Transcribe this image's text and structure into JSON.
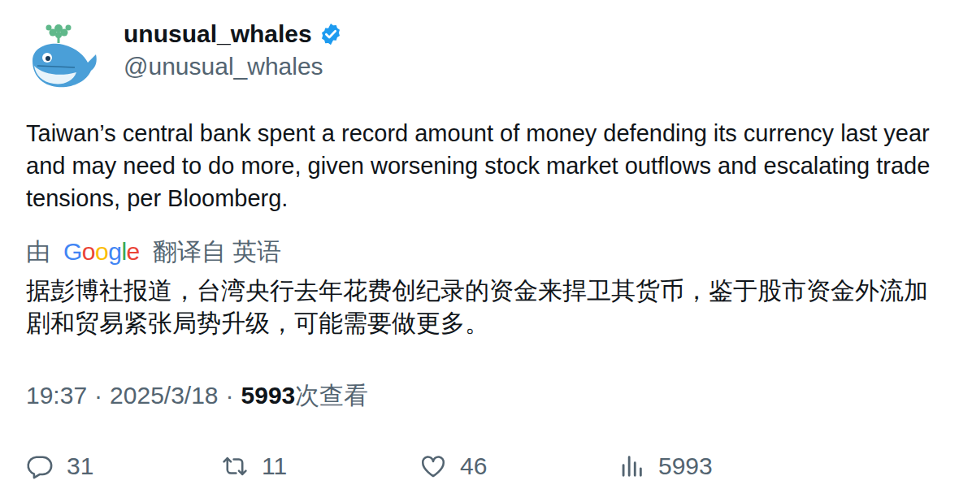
{
  "author": {
    "name": "unusual_whales",
    "verified": true,
    "handle": "@unusual_whales"
  },
  "text": "Taiwan’s central bank spent a record amount of money defending its currency last year and may need to do more, given worsening stock market outflows and escalating trade tensions, per Bloomberg.",
  "translation": {
    "prefix": "由",
    "provider": "Google",
    "label": "翻译自 英语",
    "text": "据彭博社报道，台湾央行去年花费创纪录的资金来捍卫其货币，鉴于股市资金外流加剧和贸易紧张局势升级，可能需要做更多。"
  },
  "meta": {
    "time": "19:37",
    "separator": "·",
    "date": "2025/3/18",
    "views": "5993",
    "views_label": "次查看"
  },
  "actions": [
    {
      "kind": "reply",
      "count": "31"
    },
    {
      "kind": "retweet",
      "count": "11"
    },
    {
      "kind": "like",
      "count": "46"
    },
    {
      "kind": "views",
      "count": "5993"
    }
  ]
}
